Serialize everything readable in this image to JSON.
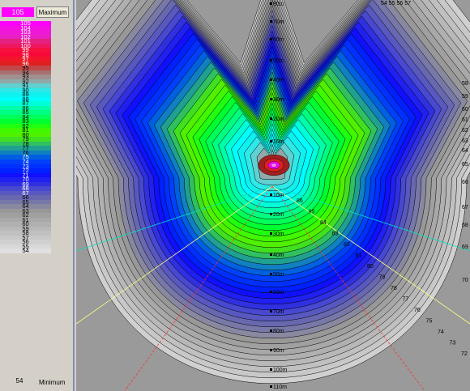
{
  "legend": {
    "max_value": "105",
    "max_button_label": "Maximum",
    "min_value": "54",
    "min_label": "Minimum",
    "scale": [
      {
        "label": "105",
        "color": "#ff00ff"
      },
      {
        "label": "104",
        "color": "#f610e8"
      },
      {
        "label": "103",
        "color": "#ef18d6"
      },
      {
        "label": "102",
        "color": "#e820c4"
      },
      {
        "label": "101",
        "color": "#e62080"
      },
      {
        "label": "100",
        "color": "#ef1860"
      },
      {
        "label": "99",
        "color": "#f51040"
      },
      {
        "label": "98",
        "color": "#f80838"
      },
      {
        "label": "97",
        "color": "#f01828"
      },
      {
        "label": "96",
        "color": "#e02020"
      },
      {
        "label": "95",
        "color": "#c04848"
      },
      {
        "label": "94",
        "color": "#a87070"
      },
      {
        "label": "93",
        "color": "#a09090"
      },
      {
        "label": "92",
        "color": "#90a8a8"
      },
      {
        "label": "91",
        "color": "#60d0d0"
      },
      {
        "label": "90",
        "color": "#30e8e8"
      },
      {
        "label": "89",
        "color": "#10f0f0"
      },
      {
        "label": "88",
        "color": "#00ffff"
      },
      {
        "label": "87",
        "color": "#00ffd8"
      },
      {
        "label": "86",
        "color": "#00ffa8"
      },
      {
        "label": "85",
        "color": "#00ff80"
      },
      {
        "label": "84",
        "color": "#00ff58"
      },
      {
        "label": "83",
        "color": "#00ff30"
      },
      {
        "label": "82",
        "color": "#20ff10"
      },
      {
        "label": "81",
        "color": "#40f800"
      },
      {
        "label": "80",
        "color": "#50f000"
      },
      {
        "label": "79",
        "color": "#40e020"
      },
      {
        "label": "78",
        "color": "#30c060"
      },
      {
        "label": "77",
        "color": "#20a090"
      },
      {
        "label": "76",
        "color": "#1080c0"
      },
      {
        "label": "75",
        "color": "#0060e0"
      },
      {
        "label": "74",
        "color": "#0040f8"
      },
      {
        "label": "73",
        "color": "#0030ff"
      },
      {
        "label": "72",
        "color": "#0020ff"
      },
      {
        "label": "71",
        "color": "#1010ff"
      },
      {
        "label": "70",
        "color": "#2020f0"
      },
      {
        "label": "69",
        "color": "#3030e0"
      },
      {
        "label": "68",
        "color": "#4848d0"
      },
      {
        "label": "67",
        "color": "#5858c0"
      },
      {
        "label": "66",
        "color": "#6868b0"
      },
      {
        "label": "65",
        "color": "#7878a8"
      },
      {
        "label": "64",
        "color": "#8888a0"
      },
      {
        "label": "63",
        "color": "#989898"
      },
      {
        "label": "62",
        "color": "#a0a0a0"
      },
      {
        "label": "61",
        "color": "#a8a8a8"
      },
      {
        "label": "60",
        "color": "#b0b0b0"
      },
      {
        "label": "59",
        "color": "#b8b8b8"
      },
      {
        "label": "58",
        "color": "#c0c0c0"
      },
      {
        "label": "57",
        "color": "#c8c8c8"
      },
      {
        "label": "56",
        "color": "#d0d0d0"
      },
      {
        "label": "55",
        "color": "#d8d8d8"
      },
      {
        "label": "54",
        "color": "#e0e0e0"
      }
    ]
  },
  "plot": {
    "distance_labels": [
      "80m",
      "70m",
      "60m",
      "50m",
      "40m",
      "30m",
      "20m",
      "10m",
      "10m",
      "20m",
      "30m",
      "40m",
      "50m",
      "60m",
      "70m",
      "80m",
      "90m",
      "100m",
      "110m",
      "120m"
    ],
    "right_edge_labels": [
      "58",
      "59",
      "60",
      "61",
      "62",
      "63",
      "64",
      "65",
      "66",
      "67",
      "68",
      "69",
      "70"
    ],
    "top_right_labels": "54 55 56  57",
    "contour_labels": [
      "86",
      "85",
      "84",
      "83",
      "82",
      "81",
      "80",
      "79",
      "78",
      "77",
      "76",
      "75",
      "74",
      "73",
      "72"
    ]
  }
}
